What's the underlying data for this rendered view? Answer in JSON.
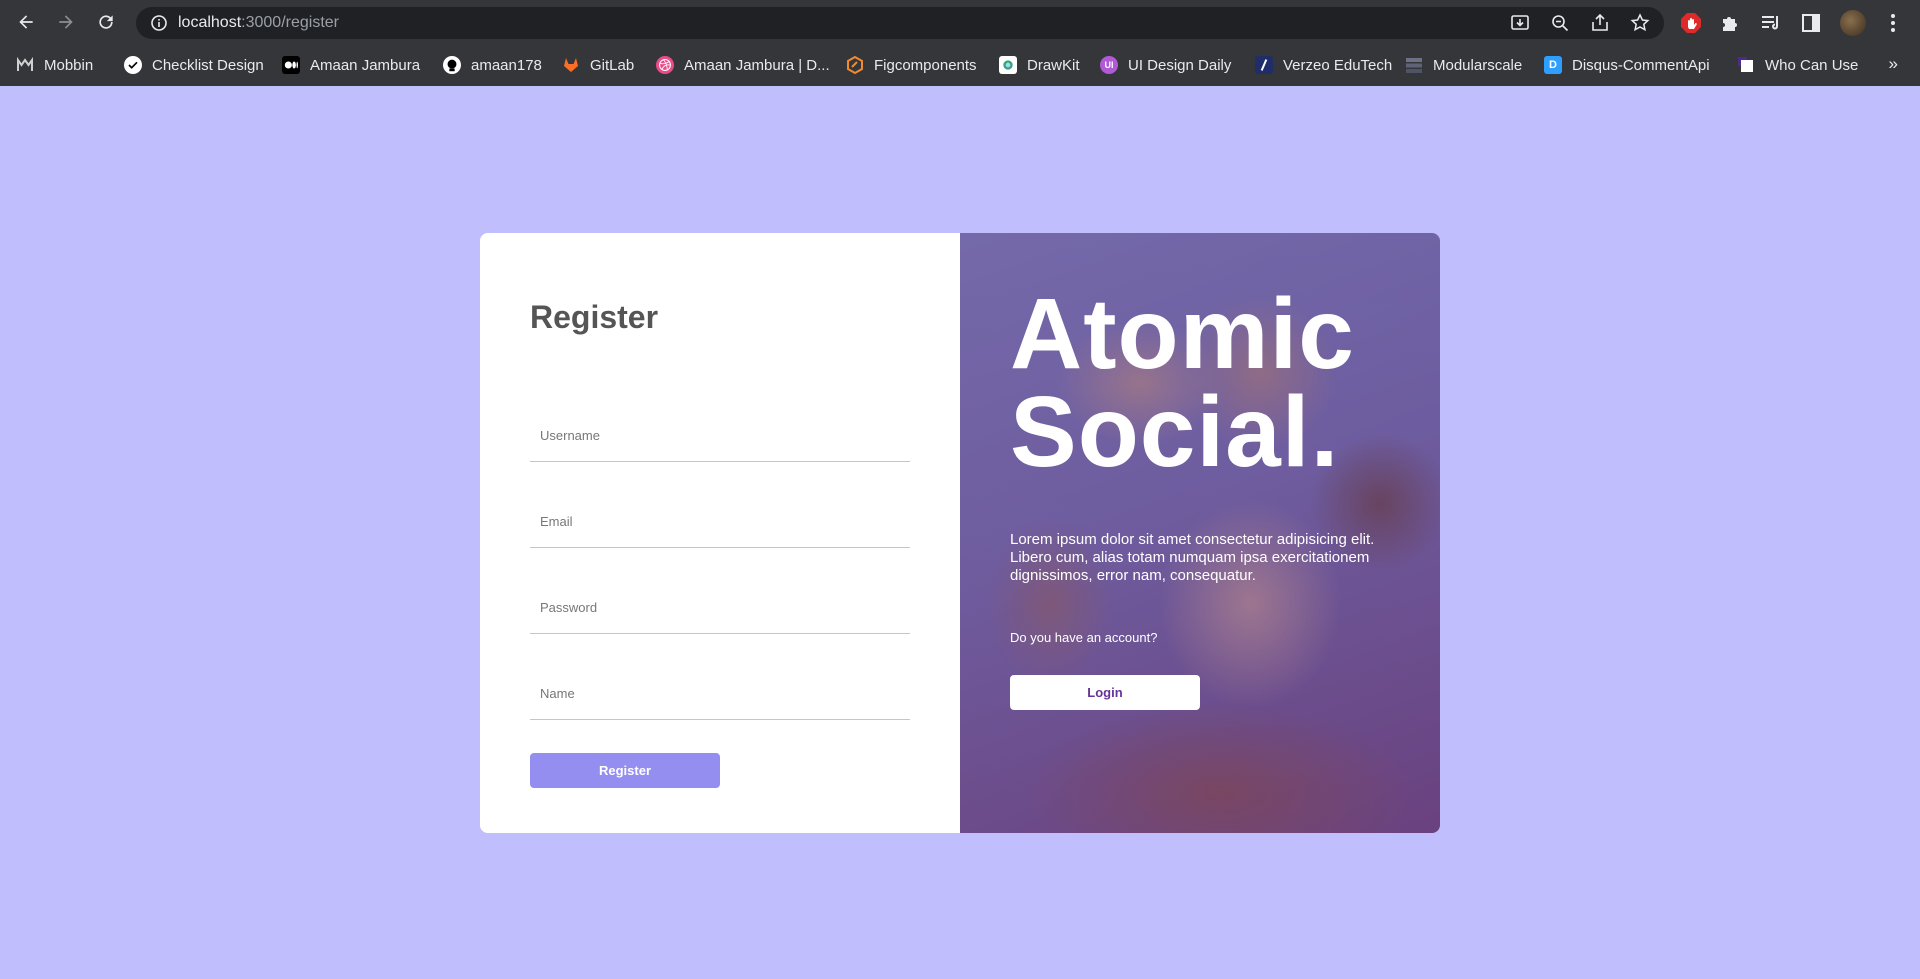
{
  "browser": {
    "url_host": "localhost",
    "url_path": ":3000/register",
    "bookmarks": [
      {
        "label": "Mobbin",
        "icon": "mobbin-icon",
        "color": "#2b2b2b"
      },
      {
        "label": "Checklist Design",
        "icon": "checklist-icon",
        "color": "#ffffff"
      },
      {
        "label": "Amaan Jambura",
        "icon": "medium-icon",
        "color": "#000000"
      },
      {
        "label": "amaan178",
        "icon": "github-icon",
        "color": "#ffffff"
      },
      {
        "label": "GitLab",
        "icon": "gitlab-icon",
        "color": "#fc6d26"
      },
      {
        "label": "Amaan Jambura | D...",
        "icon": "dribbble-icon",
        "color": "#ea4c89"
      },
      {
        "label": "Figcomponents",
        "icon": "figcomponents-icon",
        "color": "#f28a2e"
      },
      {
        "label": "DrawKit",
        "icon": "drawkit-icon",
        "color": "#3aa17e"
      },
      {
        "label": "UI Design Daily",
        "icon": "ui-design-daily-icon",
        "color": "#b05ad6"
      },
      {
        "label": "Verzeo EduTech",
        "icon": "verzeo-icon",
        "color": "#1f2d6b"
      },
      {
        "label": "Modularscale",
        "icon": "modularscale-icon",
        "color": "#5f6378"
      },
      {
        "label": "Disqus-CommentApi",
        "icon": "disqus-icon",
        "color": "#2e9fff"
      },
      {
        "label": "Who Can Use",
        "icon": "who-can-use-icon",
        "color": "#ffffff"
      }
    ],
    "more_glyph": "»"
  },
  "register": {
    "title": "Register",
    "fields": {
      "username": "Username",
      "email": "Email",
      "password": "Password",
      "name": "Name"
    },
    "button": "Register"
  },
  "promo": {
    "headline_line1": "Atomic",
    "headline_line2": "Social.",
    "blurb": "Lorem ipsum dolor sit amet consectetur adipisicing elit. Libero cum, alias totam numquam ipsa exercitationem dignissimos, error nam, consequatur.",
    "question": "Do you have an account?",
    "login_button": "Login"
  },
  "colors": {
    "page_bg": "#c1befd",
    "register_button": "#938eef",
    "login_text": "#663399"
  }
}
